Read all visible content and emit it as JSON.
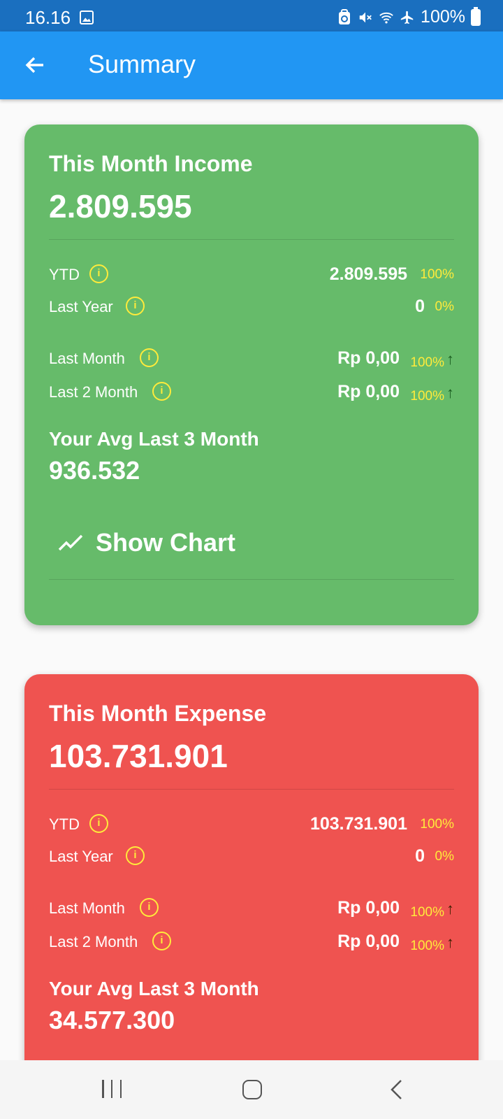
{
  "status_bar": {
    "time": "16.16",
    "battery": "100%",
    "icons": [
      "gallery-icon",
      "nfc-lock-icon",
      "mute-icon",
      "wifi-icon",
      "airplane-icon",
      "battery-icon"
    ]
  },
  "app_bar": {
    "title": "Summary",
    "back_icon": "arrow-left-icon",
    "color": "#2196f3"
  },
  "income_card": {
    "color": "#66bb6a",
    "title": "This Month Income",
    "amount": "2.809.595",
    "ytd": {
      "label": "YTD",
      "value": "2.809.595",
      "pct": "100%"
    },
    "last_year": {
      "label": "Last Year",
      "value": "0",
      "pct": "0%"
    },
    "last_month": {
      "label": "Last Month",
      "value": "Rp 0,00",
      "pct": "100%",
      "trend": "↑"
    },
    "last_2_month": {
      "label": "Last 2 Month",
      "value": "Rp 0,00",
      "pct": "100%",
      "trend": "↑"
    },
    "avg_label": "Your Avg Last 3 Month",
    "avg_value": "936.532",
    "show_chart_label": "Show Chart"
  },
  "expense_card": {
    "color": "#ef5350",
    "title": "This Month Expense",
    "amount": "103.731.901",
    "ytd": {
      "label": "YTD",
      "value": "103.731.901",
      "pct": "100%"
    },
    "last_year": {
      "label": "Last Year",
      "value": "0",
      "pct": "0%"
    },
    "last_month": {
      "label": "Last Month",
      "value": "Rp 0,00",
      "pct": "100%",
      "trend": "↑"
    },
    "last_2_month": {
      "label": "Last 2 Month",
      "value": "Rp 0,00",
      "pct": "100%",
      "trend": "↑"
    },
    "avg_label": "Your Avg Last 3 Month",
    "avg_value": "34.577.300"
  },
  "nav_bar": {
    "icons": [
      "recent-apps-icon",
      "home-icon",
      "back-icon"
    ]
  }
}
